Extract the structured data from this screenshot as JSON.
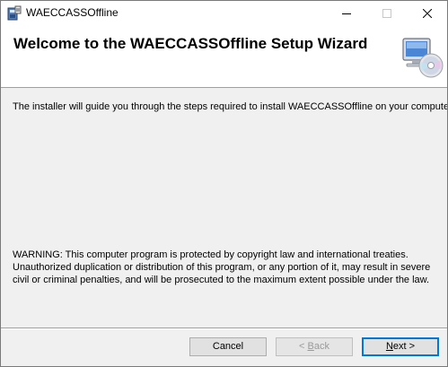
{
  "window": {
    "title": "WAECCASSOffline",
    "minimize_icon": "minimize-icon",
    "maximize_icon": "maximize-icon",
    "close_icon": "close-icon"
  },
  "header": {
    "title": "Welcome to the WAECCASSOffline Setup Wizard",
    "graphic_icon": "computer-with-cd-icon"
  },
  "body": {
    "intro": "The installer will guide you through the steps required to install WAECCASSOffline on your computer.",
    "warning": "WARNING: This computer program is protected by copyright law and international treaties. Unauthorized duplication or distribution of this program, or any portion of it, may result in severe civil or criminal penalties, and will be prosecuted to the maximum extent possible under the law."
  },
  "buttons": {
    "cancel": "Cancel",
    "back_prefix": "< ",
    "back_key": "B",
    "back_rest": "ack",
    "back_enabled": false,
    "next_key": "N",
    "next_rest": "ext >",
    "next_default": true
  },
  "colors": {
    "focus_border": "#0078d7",
    "dialog_background": "#f0f0f0"
  }
}
